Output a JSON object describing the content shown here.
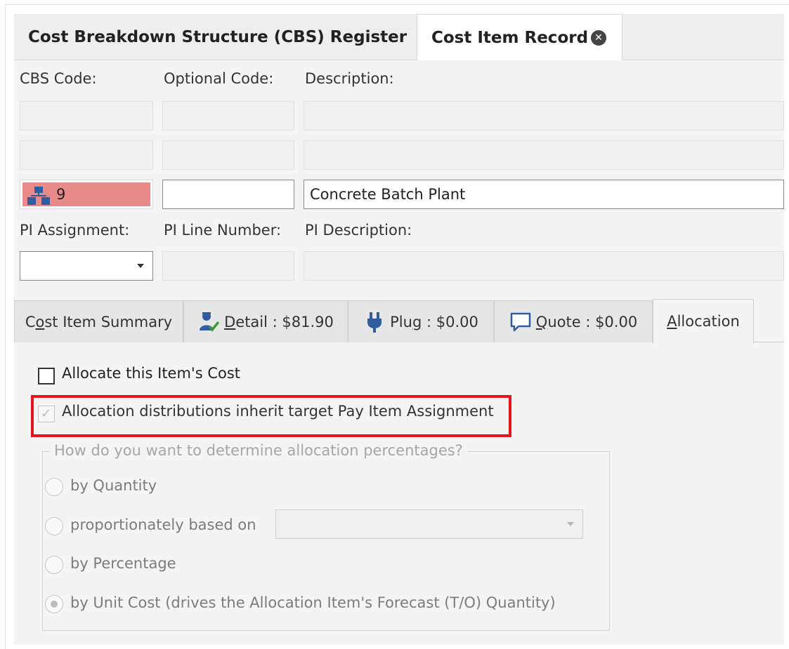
{
  "doc_tabs": {
    "register_label": "Cost Breakdown Structure (CBS) Register",
    "record_label": "Cost Item Record",
    "close_icon": "close-icon"
  },
  "labels": {
    "cbs_code": "CBS Code:",
    "optional_code": "Optional Code:",
    "description": "Description:",
    "pi_assignment": "PI Assignment:",
    "pi_line_number": "PI Line Number:",
    "pi_description": "PI Description:"
  },
  "record": {
    "cbs_code": "9",
    "optional_code": "",
    "description": "Concrete Batch Plant",
    "pi_assignment": "",
    "cbs_icon": "hierarchy-icon",
    "cbs_highlight_color": "#e88a8a"
  },
  "sub_tabs": [
    {
      "label": "Cost Item Summary",
      "icon": ""
    },
    {
      "label": "Detail : $81.90",
      "icon": "person-check-icon"
    },
    {
      "label": "Plug : $0.00",
      "icon": "plug-icon"
    },
    {
      "label": "Quote : $0.00",
      "icon": "speech-bubble-icon"
    },
    {
      "label": "Allocation",
      "icon": ""
    }
  ],
  "allocation": {
    "allocate_label": "Allocate this Item's Cost",
    "allocate_checked": false,
    "inherit_label": "Allocation distributions inherit target Pay Item Assignment",
    "inherit_checked": true,
    "group_title": "How do you want to determine allocation percentages?",
    "options": [
      {
        "label": "by Quantity",
        "selected": false
      },
      {
        "label": "proportionately based on",
        "selected": false
      },
      {
        "label": "by Percentage",
        "selected": false
      },
      {
        "label": "by Unit Cost (drives the Allocation Item's Forecast (T/O) Quantity)",
        "selected": true
      }
    ],
    "proportion_select_value": "",
    "highlight_color": "#e8141c"
  }
}
